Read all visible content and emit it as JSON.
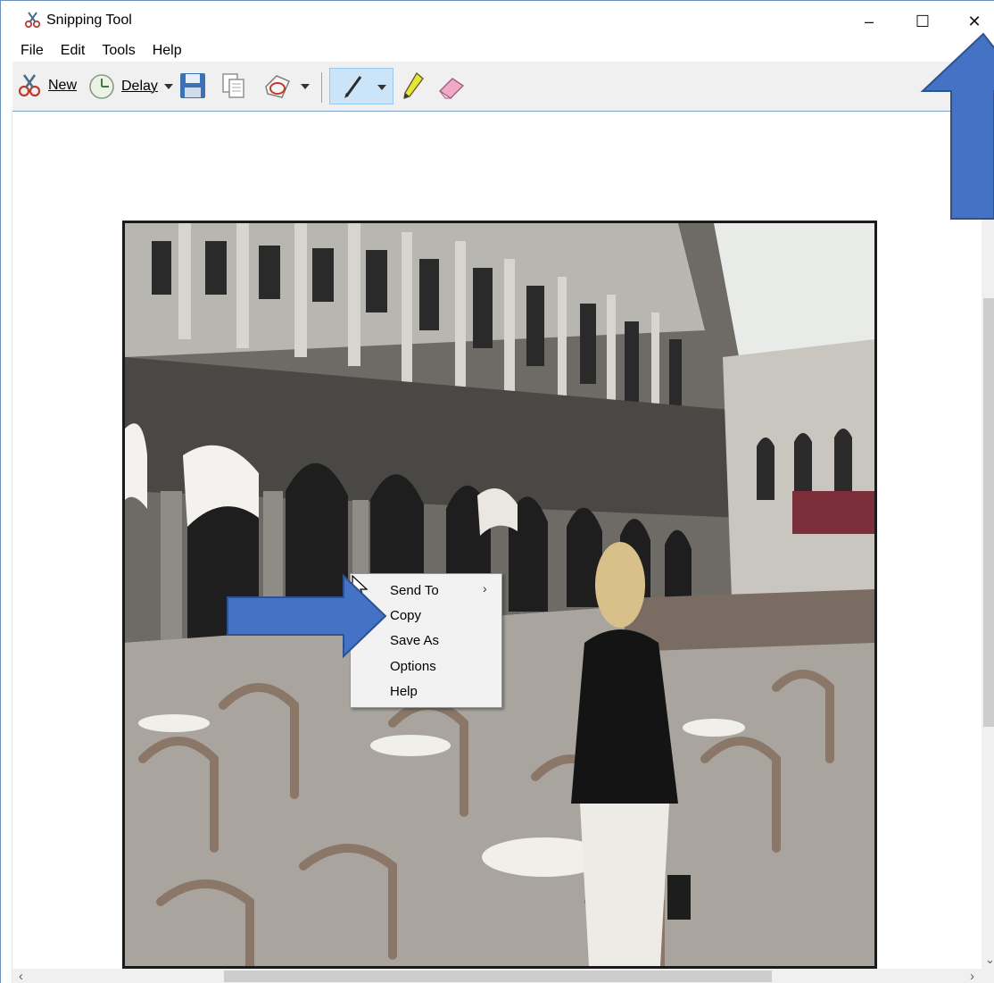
{
  "window": {
    "title": "Snipping Tool",
    "controls": {
      "minimize": "–",
      "maximize": "☐",
      "close": "✕"
    }
  },
  "menubar": {
    "items": [
      {
        "label": "File"
      },
      {
        "label": "Edit"
      },
      {
        "label": "Tools"
      },
      {
        "label": "Help"
      }
    ]
  },
  "toolbar": {
    "new_label": "New",
    "delay_label": "Delay",
    "icons": [
      "scissors-icon",
      "clock-icon",
      "save-icon",
      "copy-icon",
      "send-icon",
      "pen-icon",
      "highlighter-icon",
      "eraser-icon"
    ]
  },
  "context_menu": {
    "items": [
      {
        "label": "Send To",
        "submenu": "›"
      },
      {
        "label": "Copy"
      },
      {
        "label": "Save As"
      },
      {
        "label": "Options"
      },
      {
        "label": "Help"
      }
    ]
  },
  "scrollbars": {
    "left_arrow": "‹",
    "right_arrow": "›",
    "down_arrow": "⌄"
  },
  "colors": {
    "annotation_arrow": "#4472c4",
    "annotation_arrow_border": "#2f528f",
    "toolbar_bg": "#f0f0f0",
    "pen_selected_bg": "#cce4f7"
  }
}
